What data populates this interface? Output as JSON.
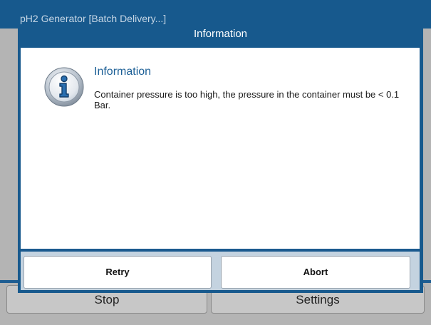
{
  "app": {
    "title": "pH2 Generator  [Batch Delivery...]",
    "buttons": {
      "stop_label": "Stop",
      "settings_label": "Settings"
    }
  },
  "dialog": {
    "title": "Information",
    "icon": "info-icon",
    "heading": "Information",
    "message": "Container pressure is too high, the pressure in the container must be < 0.1 Bar.",
    "buttons": {
      "retry_label": "Retry",
      "abort_label": "Abort"
    }
  },
  "colors": {
    "titlebar": "#17598d",
    "accent_text": "#1c5f96",
    "app_background": "#b4b4b4",
    "dialog_footer": "#c4d3e0"
  }
}
